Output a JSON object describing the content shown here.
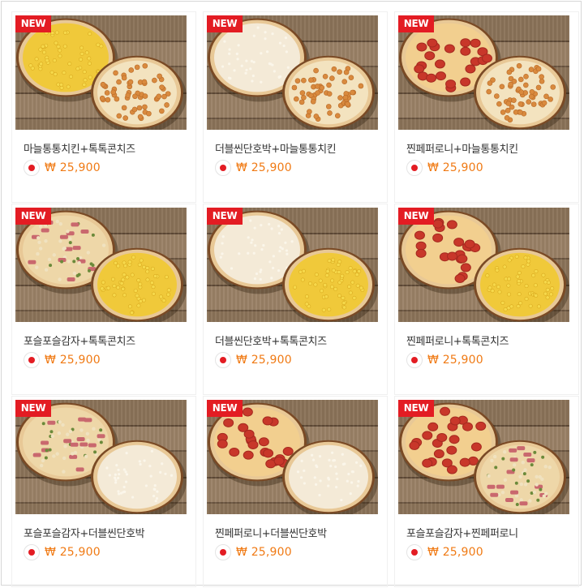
{
  "badge_label": "NEW",
  "colors": {
    "badge": "#e31c23",
    "price": "#f07a14",
    "dot": "#e31c23"
  },
  "products": [
    {
      "title": "마늘통통치킨+톡톡콘치즈",
      "price": "₩ 25,900",
      "pizza_left": "corn",
      "pizza_right": "chicken"
    },
    {
      "title": "더블씬단호박+마늘통통치킨",
      "price": "₩ 25,900",
      "pizza_left": "pumpkin",
      "pizza_right": "chicken"
    },
    {
      "title": "찐페퍼로니+마늘통통치킨",
      "price": "₩ 25,900",
      "pizza_left": "pepperoni",
      "pizza_right": "chicken"
    },
    {
      "title": "포슬포슬감자+톡톡콘치즈",
      "price": "₩ 25,900",
      "pizza_left": "potato",
      "pizza_right": "corn"
    },
    {
      "title": "더블씬단호박+톡톡콘치즈",
      "price": "₩ 25,900",
      "pizza_left": "pumpkin",
      "pizza_right": "corn"
    },
    {
      "title": "찐페퍼로니+톡톡콘치즈",
      "price": "₩ 25,900",
      "pizza_left": "pepperoni",
      "pizza_right": "corn"
    },
    {
      "title": "포슬포슬감자+더블씬단호박",
      "price": "₩ 25,900",
      "pizza_left": "potato",
      "pizza_right": "pumpkin"
    },
    {
      "title": "찐페퍼로니+더블씬단호박",
      "price": "₩ 25,900",
      "pizza_left": "pepperoni",
      "pizza_right": "pumpkin"
    },
    {
      "title": "포슬포슬감자+찐페퍼로니",
      "price": "₩ 25,900",
      "pizza_left": "pepperoni",
      "pizza_right": "potato"
    }
  ]
}
